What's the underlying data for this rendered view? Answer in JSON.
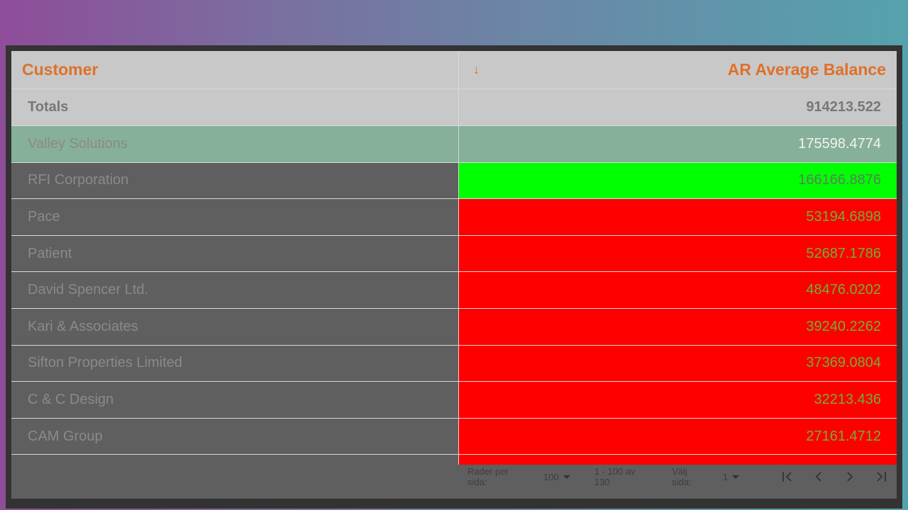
{
  "table": {
    "columns": [
      "Customer",
      "AR Average Balance"
    ],
    "totals": {
      "label": "Totals",
      "value": "914213.522"
    },
    "rows": [
      {
        "customer": "Valley Solutions",
        "value": "175598.4774"
      },
      {
        "customer": "RFI Corporation",
        "value": "166166.8876"
      },
      {
        "customer": "Pace",
        "value": "53194.6898"
      },
      {
        "customer": "Patient",
        "value": "52687.1786"
      },
      {
        "customer": "David Spencer Ltd.",
        "value": "48476.0202"
      },
      {
        "customer": "Kari & Associates",
        "value": "39240.2262"
      },
      {
        "customer": "Sifton Properties Limited",
        "value": "37369.0804"
      },
      {
        "customer": "C & C Design",
        "value": "32213.436"
      },
      {
        "customer": "CAM Group",
        "value": "27161.4712"
      }
    ]
  },
  "pager": {
    "rows_per_page_label": "Rader per sida:",
    "rows_per_page_value": "100",
    "range": "1 - 100 av 130",
    "select_page_label": "Välj sida:",
    "page_value": "1"
  },
  "colors": {
    "accent": "#e0702a",
    "good": "#00ff00",
    "bad": "#ff0000",
    "selected": "#86b09a"
  }
}
